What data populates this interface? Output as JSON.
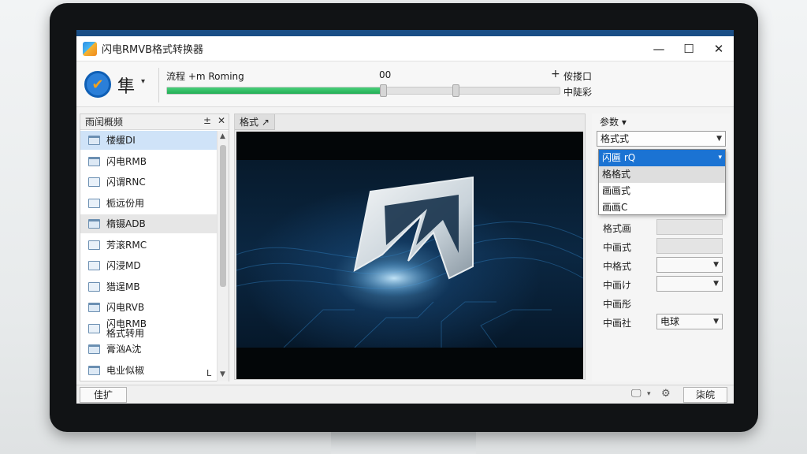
{
  "window": {
    "title": "闪电RMVB格式转换器",
    "controls": {
      "minimize": "—",
      "maximize": "☐",
      "close": "✕"
    }
  },
  "toolbar": {
    "tool_label": "隼",
    "tool_caret": "▾",
    "progress_label": "流程 +m Roming",
    "progress_value": "00",
    "progress_fraction": 0.55,
    "plus": "+",
    "right_line1": "侒搂口",
    "right_line2": "中陡彩"
  },
  "left_panel": {
    "header": "雨闰概频",
    "header_icons": [
      "±",
      "✕"
    ],
    "items": [
      {
        "label": "楼缓DI",
        "kind": "folder",
        "state": "selected"
      },
      {
        "label": "闪电RMB",
        "kind": "folder",
        "state": ""
      },
      {
        "label": "闪谓RNC",
        "kind": "file",
        "state": ""
      },
      {
        "label": "栀远份用",
        "kind": "file",
        "state": ""
      },
      {
        "label": "楕镊ADB",
        "kind": "folder",
        "state": "highlight"
      },
      {
        "label": "芳滚RMC",
        "kind": "file",
        "state": ""
      },
      {
        "label": "闪浸MD",
        "kind": "file",
        "state": ""
      },
      {
        "label": "猎逞MB",
        "kind": "file",
        "state": ""
      },
      {
        "label": "闪电RVB",
        "kind": "folder",
        "state": ""
      },
      {
        "label": "闪电RMB\n格式转用",
        "kind": "file",
        "state": ""
      },
      {
        "label": "膏汹A沈",
        "kind": "folder",
        "state": ""
      },
      {
        "label": "电业似椒",
        "kind": "folder",
        "state": ""
      }
    ],
    "scroll_up": "▲",
    "scroll_down": "▼",
    "corner_icon": "L"
  },
  "preview": {
    "tab": "格式 ↗"
  },
  "right_panel": {
    "title": "参数 ▾",
    "format_select": "格式式",
    "dropdown_options": [
      {
        "label": "闪匾 rQ",
        "state": "active"
      },
      {
        "label": "格格式",
        "state": "hover"
      },
      {
        "label": "画画式",
        "state": ""
      },
      {
        "label": "画画C",
        "state": ""
      }
    ],
    "params": [
      {
        "label": "格式画",
        "control": "box"
      },
      {
        "label": "中画式",
        "control": "box"
      },
      {
        "label": "中格式",
        "control": "select",
        "value": ""
      },
      {
        "label": "中画け",
        "control": "select",
        "value": ""
      },
      {
        "label": "中画彤",
        "control": "none"
      },
      {
        "label": "中画社",
        "control": "select",
        "value": "电球"
      }
    ]
  },
  "statusbar": {
    "left_button": "佳扩",
    "right_button": "柒皖",
    "icons": [
      "monitor-icon",
      "settings-icon"
    ]
  },
  "device": {
    "logo": ""
  }
}
